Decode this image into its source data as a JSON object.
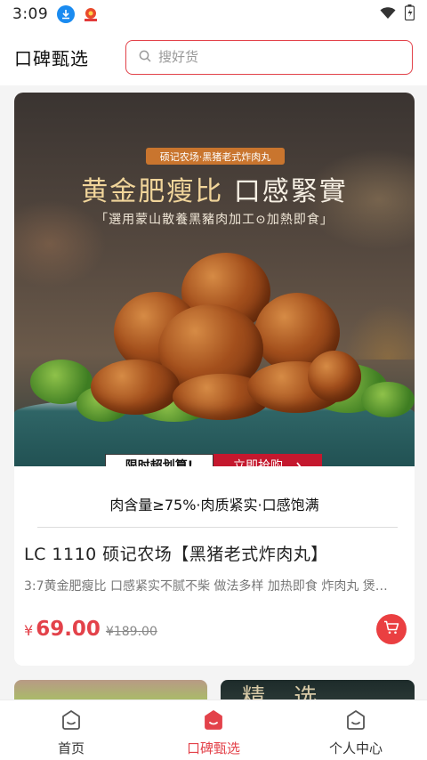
{
  "status_bar": {
    "time": "3:09"
  },
  "header": {
    "title": "口碑甄选",
    "search_placeholder": "搜好货"
  },
  "product": {
    "banner_tag": "硕记农场·黑猪老式炸肉丸",
    "banner_headline_gold": "黄金肥瘦比",
    "banner_headline_rest": "口感緊實",
    "banner_subtitle": "「選用蒙山散養黑豬肉加工⊙加熱即食」",
    "promo_left": "限时超划算!",
    "promo_right": "立即抢购",
    "feature_line": "肉含量≥75%·肉质紧实·口感饱满",
    "name": "LC 1110 硕记农场【黑猪老式炸肉丸】",
    "description": "3:7黄金肥瘦比 口感紧实不腻不柴 做法多样 加热即食 炸肉丸 煲…",
    "currency": "¥",
    "price": "69.00",
    "old_price": "¥189.00"
  },
  "next_card_right_text": "精 选 ",
  "bottom_nav": {
    "items": [
      {
        "label": "首页",
        "icon": "home-icon"
      },
      {
        "label": "口碑甄选",
        "icon": "select-icon"
      },
      {
        "label": "个人中心",
        "icon": "profile-icon"
      }
    ]
  },
  "colors": {
    "accent": "#e3424a",
    "promo_red": "#c4182e",
    "tag_orange": "#c9752e"
  }
}
